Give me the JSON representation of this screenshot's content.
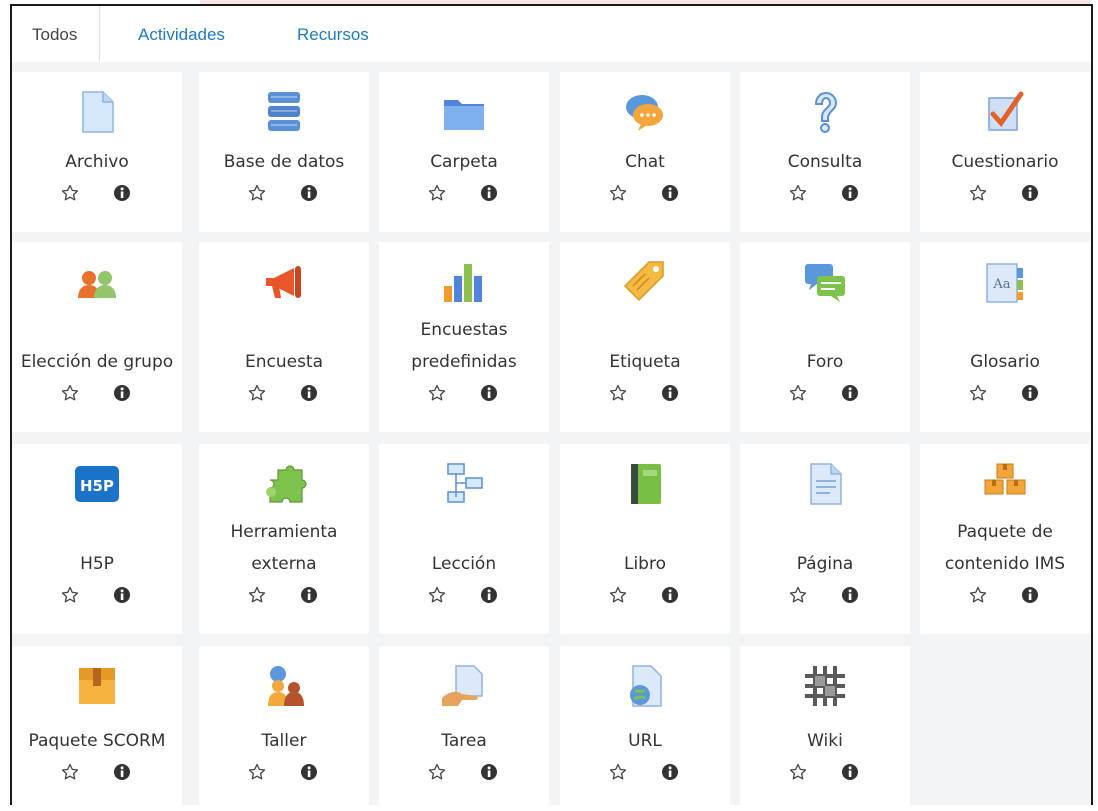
{
  "tabs": {
    "all": "Todos",
    "activities": "Actividades",
    "resources": "Recursos"
  },
  "modules": [
    {
      "label": "Archivo",
      "icon": "file-icon"
    },
    {
      "label": "Base de datos",
      "icon": "database-icon"
    },
    {
      "label": "Carpeta",
      "icon": "folder-icon"
    },
    {
      "label": "Chat",
      "icon": "chat-icon"
    },
    {
      "label": "Consulta",
      "icon": "question-icon"
    },
    {
      "label": "Cuestionario",
      "icon": "quiz-icon"
    },
    {
      "label": "Elección de grupo",
      "icon": "group-choice-icon"
    },
    {
      "label": "Encuesta",
      "icon": "megaphone-icon"
    },
    {
      "label": "Encuestas predefinidas",
      "icon": "bar-chart-icon"
    },
    {
      "label": "Etiqueta",
      "icon": "tag-icon"
    },
    {
      "label": "Foro",
      "icon": "forum-icon"
    },
    {
      "label": "Glosario",
      "icon": "glossary-icon"
    },
    {
      "label": "H5P",
      "icon": "h5p-icon"
    },
    {
      "label": "Herramienta externa",
      "icon": "puzzle-icon"
    },
    {
      "label": "Lección",
      "icon": "lesson-flow-icon"
    },
    {
      "label": "Libro",
      "icon": "book-icon"
    },
    {
      "label": "Página",
      "icon": "page-icon"
    },
    {
      "label": "Paquete de contenido IMS",
      "icon": "ims-package-icon"
    },
    {
      "label": "Paquete SCORM",
      "icon": "scorm-package-icon"
    },
    {
      "label": "Taller",
      "icon": "workshop-icon"
    },
    {
      "label": "Tarea",
      "icon": "assignment-icon"
    },
    {
      "label": "URL",
      "icon": "url-icon"
    },
    {
      "label": "Wiki",
      "icon": "wiki-icon"
    }
  ],
  "actions": {
    "star_icon": "star-outline-icon",
    "info_icon": "info-icon"
  },
  "colors": {
    "link": "#1f7bc0",
    "tile_bg": "#ffffff",
    "grid_bg": "#f3f4f5"
  }
}
